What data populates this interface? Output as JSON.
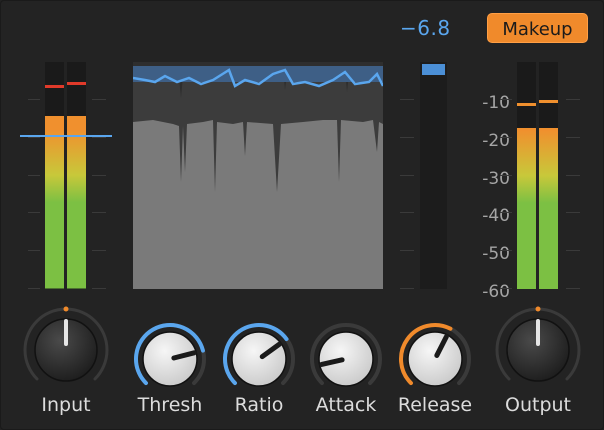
{
  "gain_reduction_readout": "−6.8",
  "makeup_label": "Makeup",
  "scale_labels": [
    "-10",
    "-20",
    "-30",
    "-40",
    "-50",
    "-60"
  ],
  "colors": {
    "accent_blue": "#5aa6ee",
    "accent_orange": "#f08a2b",
    "meter_green": "#7cc043",
    "meter_orange": "#f0902e",
    "peak_red": "#e03a2a"
  },
  "input_meter": {
    "level_fraction": 0.76,
    "peak_fraction": 0.9,
    "threshold_fraction": 0.68
  },
  "output_meter": {
    "level_fraction": 0.71,
    "peak_fraction": 0.82
  },
  "gain_reduction_fraction": 0.05,
  "knobs": [
    {
      "id": "input",
      "label": "Input",
      "value_fraction": 0.5,
      "ring_color": "#f08a2b"
    },
    {
      "id": "thresh",
      "label": "Thresh",
      "value_fraction": 0.78,
      "ring_color": "#5aa6ee"
    },
    {
      "id": "ratio",
      "label": "Ratio",
      "value_fraction": 0.7,
      "ring_color": "#5aa6ee"
    },
    {
      "id": "attack",
      "label": "Attack",
      "value_fraction": 0.12,
      "ring_color": ""
    },
    {
      "id": "release",
      "label": "Release",
      "value_fraction": 0.6,
      "ring_color": "#f08a2b"
    },
    {
      "id": "output",
      "label": "Output",
      "value_fraction": 0.5,
      "ring_color": "#f08a2b"
    }
  ]
}
